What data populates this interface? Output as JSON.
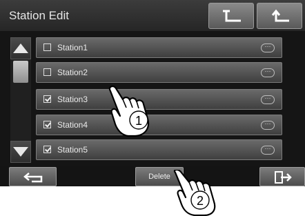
{
  "header": {
    "title": "Station Edit"
  },
  "stations": [
    {
      "label": "Station1",
      "checked": false
    },
    {
      "label": "Station2",
      "checked": false
    },
    {
      "label": "Station3",
      "checked": true
    },
    {
      "label": "Station4",
      "checked": true
    },
    {
      "label": "Station5",
      "checked": true
    }
  ],
  "more_icon": "···",
  "footer": {
    "delete_label": "Delete"
  },
  "annotations": {
    "step1": "1",
    "step2": "2"
  },
  "colors": {
    "screen_bg": "#151515",
    "row_bg": "#555555",
    "text": "#eaeaea"
  }
}
